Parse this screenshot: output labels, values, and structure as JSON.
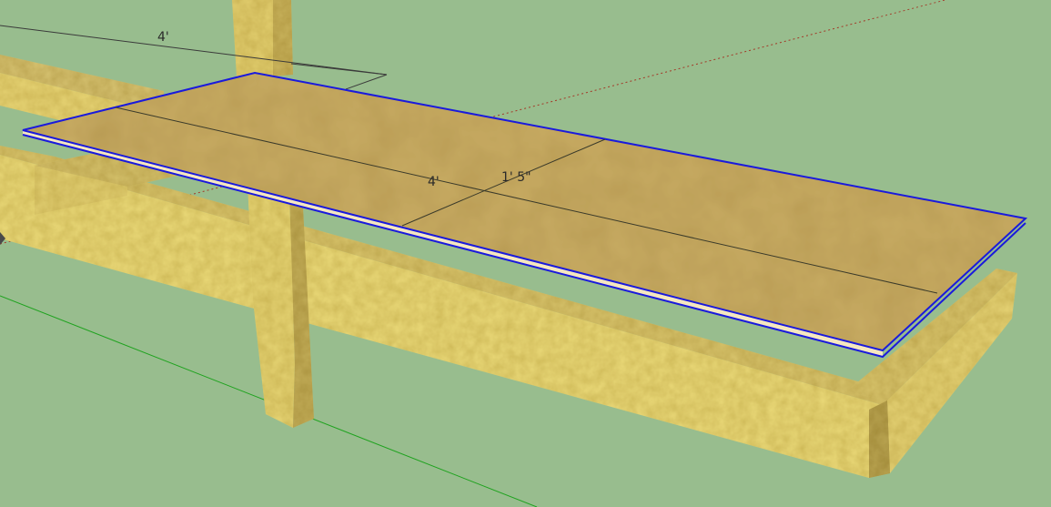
{
  "scene": {
    "background_color": "#98bd8e",
    "wood_color": "#e8d575",
    "panel_color": "#c8ac63",
    "selection_color": "#1a1adc",
    "green_axis_color": "#1fa31f",
    "red_axis_color": "#a33c2a"
  },
  "dimensions": {
    "top_width": "4'",
    "panel_width": "4'",
    "panel_section": "1' 5\""
  }
}
